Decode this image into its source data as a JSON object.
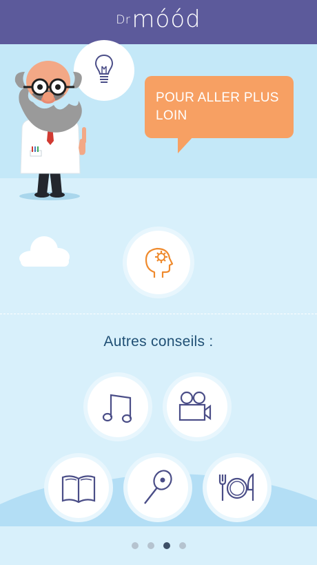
{
  "header": {
    "logo_prefix": "Dr",
    "logo_main": "móód"
  },
  "hero": {
    "bubble_text": "POUR ALLER PLUS LOIN"
  },
  "main_icon": {
    "icon": "head-gear-icon"
  },
  "section": {
    "title": "Autres conseils :"
  },
  "tips": [
    {
      "icon": "music-note-icon"
    },
    {
      "icon": "video-camera-icon"
    },
    {
      "icon": "book-icon"
    },
    {
      "icon": "tennis-racket-icon"
    },
    {
      "icon": "plate-cutlery-icon"
    }
  ],
  "pagination": {
    "total": 4,
    "active": 3
  },
  "colors": {
    "header": "#5c5a9b",
    "bubble": "#f7a063",
    "accent_orange": "#ef8a2d",
    "icon_purple": "#4a4d87",
    "title": "#1f4f74"
  }
}
